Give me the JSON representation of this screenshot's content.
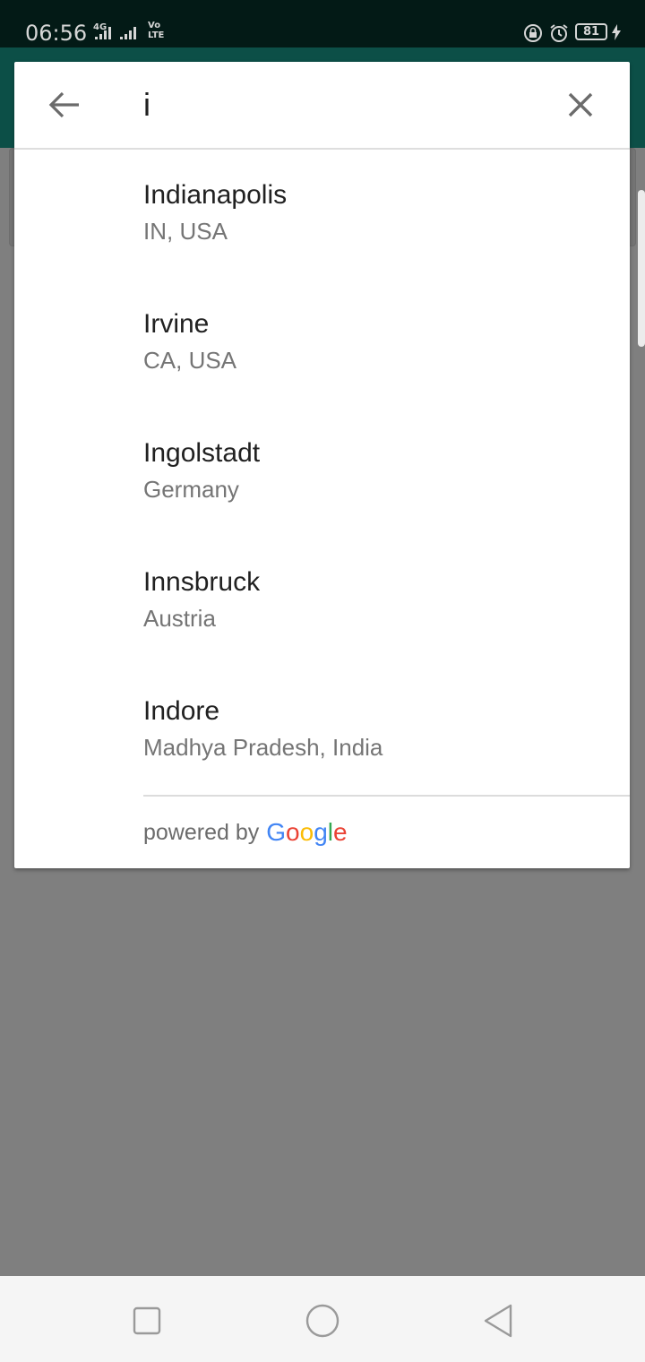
{
  "status_bar": {
    "time": "06:56",
    "network_type": "4G",
    "volte_top": "Vo",
    "volte_bottom": "LTE",
    "battery_level": "81",
    "icons": [
      "signal-icon",
      "signal-icon",
      "volte-icon",
      "rotation-lock-icon",
      "alarm-icon",
      "battery-icon",
      "charging-icon"
    ]
  },
  "search": {
    "query": "i",
    "back_icon": "arrow-left-icon",
    "clear_icon": "close-icon"
  },
  "results": [
    {
      "name": "Indianapolis",
      "detail": "IN, USA"
    },
    {
      "name": "Irvine",
      "detail": "CA, USA"
    },
    {
      "name": "Ingolstadt",
      "detail": "Germany"
    },
    {
      "name": "Innsbruck",
      "detail": "Austria"
    },
    {
      "name": "Indore",
      "detail": "Madhya Pradesh, India"
    }
  ],
  "attribution": {
    "prefix": "powered by",
    "logo_letters": [
      "G",
      "o",
      "o",
      "g",
      "l",
      "e"
    ],
    "logo_colors": [
      "#4285F4",
      "#EA4335",
      "#FBBC05",
      "#4285F4",
      "#34A853",
      "#EA4335"
    ]
  },
  "nav_bar": {
    "icons": [
      "recents-square-icon",
      "home-circle-icon",
      "back-triangle-icon"
    ]
  },
  "colors": {
    "status_bar_bg": "#031a16",
    "app_bar_bg": "#0c4f47",
    "scrim": "#7f7f7f"
  }
}
